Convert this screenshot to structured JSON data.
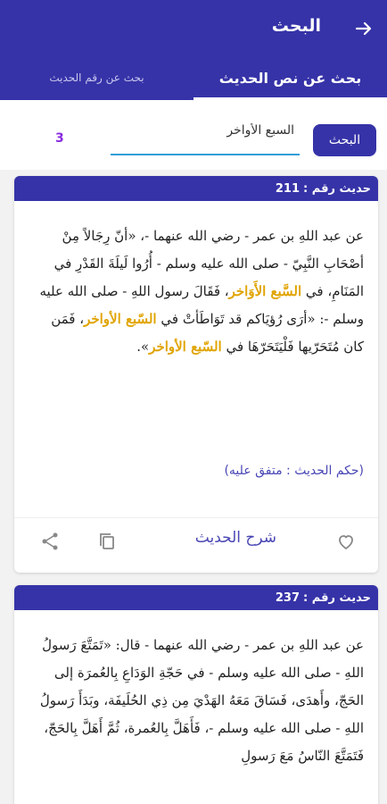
{
  "header": {
    "title": "البحث",
    "back_icon": "arrow-right-icon"
  },
  "tabs": [
    {
      "label": "بحث عن نص الحديث",
      "active": true
    },
    {
      "label": "بحث عن رقم الحديث",
      "active": false
    }
  ],
  "search": {
    "button_label": "البحث",
    "value": "السبع الأواخر",
    "result_count": "3"
  },
  "results": [
    {
      "header_label": "حديث رقم :",
      "number": "211",
      "text_parts": [
        {
          "t": "عن عبد اللهِ بن عمر - رضي الله عنهما -، «أنّ رِجَالاً مِنْ أصْحَابِ النَّبِيّ - صلى الله عليه وسلم - أُرُوا لَيلَةَ القَدْرِ في المَنَامِ، في ",
          "hl": false
        },
        {
          "t": "السَّبع الأَوَاخر",
          "hl": true
        },
        {
          "t": "، فَقَالَ رسول اللهِ - صلى الله عليه وسلم -: «أرَى رُؤيَاكم قد تَوَاطَأتْ في ",
          "hl": false
        },
        {
          "t": "السّبع الأواخر",
          "hl": true
        },
        {
          "t": "، فَمَن كان مُتَحَرّيها فَلْيَتَحَرّهَا في ",
          "hl": false
        },
        {
          "t": "السّبع الأواخر",
          "hl": true
        },
        {
          "t": "».",
          "hl": false
        }
      ],
      "ruling": "(حكم الحديث : متفق عليه)",
      "explain_label": "شرح الحديث"
    },
    {
      "header_label": "حديث رقم :",
      "number": "237",
      "text_parts": [
        {
          "t": "عن عبد اللهِ بن عمر - رضي الله عنهما - قال: «تَمَتَّعَ رَسولُ اللهِ - صلى الله عليه وسلم - في حَجّةِ الوَدَاعِ بِالعُمرَة إلى الحَجّ، وأَهدَى، فَسَاقَ مَعَهُ الهَدْيَ مِن ذِي الحُلَيفَة، وبَدَأَ رَسولُ اللهِ - صلى الله عليه وسلم -، فَأَهَلَّ بِالعُمرة، ثُمَّ أَهَلَّ بِالحَجّ، فَتَمَتَّعَ النّاسُ مَعَ رَسولِ",
          "hl": false
        }
      ]
    }
  ],
  "colors": {
    "primary": "#3633a8",
    "highlight": "#e0a400",
    "count": "#8a2be2",
    "accent_underline": "#2f9fd8"
  },
  "icons": {
    "favorite": "heart-outline-icon",
    "copy": "copy-icon",
    "share": "share-icon"
  }
}
